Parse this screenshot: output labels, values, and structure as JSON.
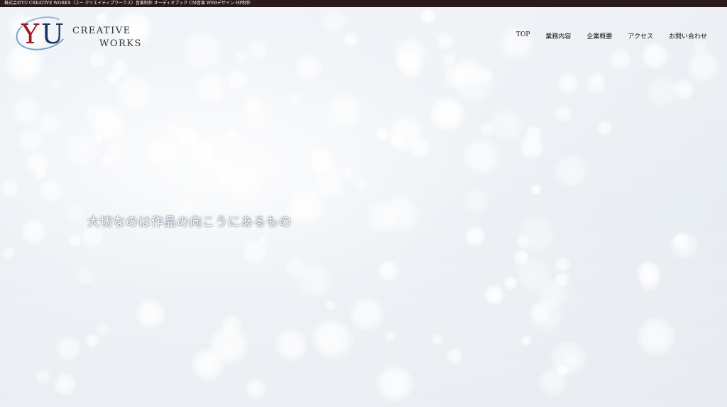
{
  "topbar": {
    "text": "株式会社YU CREATIVE WORKS（ユー クリエイティブワークス）音楽制作 オーディオブック CM音楽 WEBデザイン HP制作"
  },
  "logo": {
    "letter_y": "Y",
    "letter_u": "U",
    "creative": "CREATIVE",
    "works": "WORKS"
  },
  "nav": {
    "items": [
      {
        "label": "TOP"
      },
      {
        "label": "業務内容"
      },
      {
        "label": "企業概要"
      },
      {
        "label": "アクセス"
      },
      {
        "label": "お問い合わせ"
      }
    ]
  },
  "hero": {
    "tagline": "大切なのは作品の向こうにあるもの"
  },
  "colors": {
    "topbar_bg": "#2a1a1a",
    "logo_red": "#9b1c24",
    "logo_navy": "#1d3660",
    "logo_ring": "#7ba1cc"
  }
}
